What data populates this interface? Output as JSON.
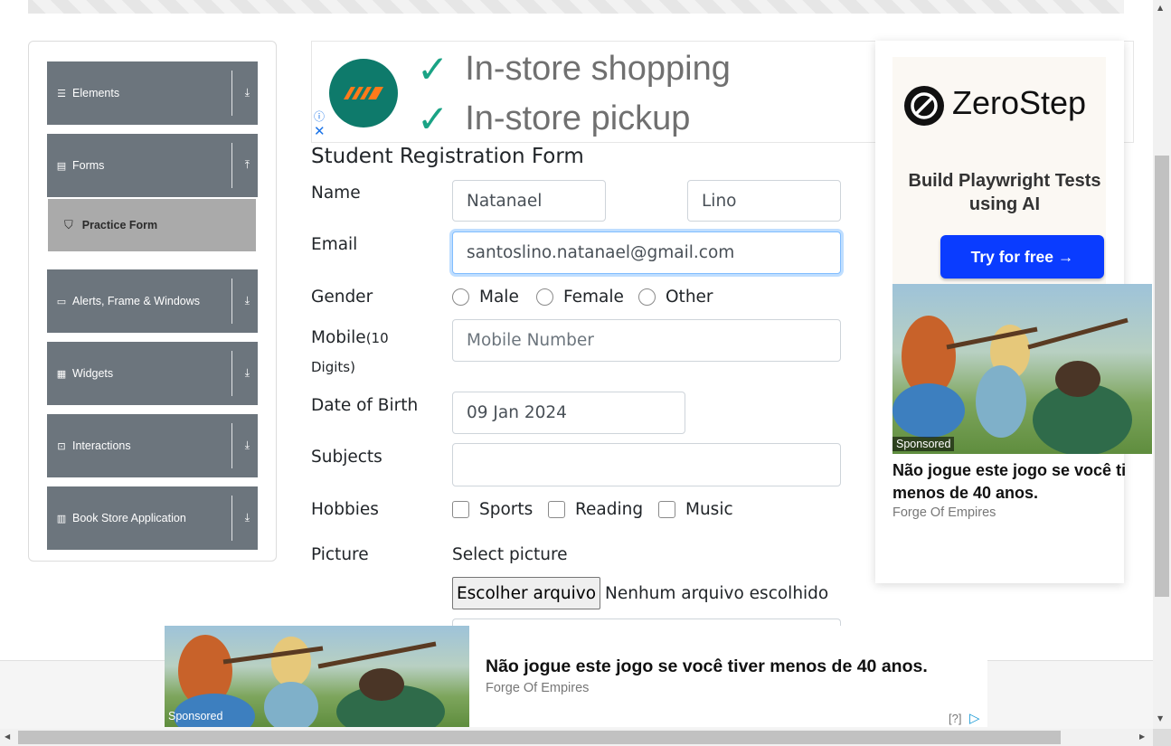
{
  "sidebar": {
    "groups": [
      {
        "label": "Elements",
        "icon": "menu-icon",
        "arrow": "⤓"
      },
      {
        "label": "Forms",
        "icon": "document-icon",
        "arrow": "⤒"
      },
      {
        "label": "Alerts, Frame & Windows",
        "icon": "window-icon",
        "arrow": "⤓"
      },
      {
        "label": "Widgets",
        "icon": "grid-icon",
        "arrow": "⤓"
      },
      {
        "label": "Interactions",
        "icon": "cursor-icon",
        "arrow": "⤓"
      },
      {
        "label": "Book Store Application",
        "icon": "books-icon",
        "arrow": "⤓"
      }
    ],
    "active_item": "Practice Form"
  },
  "ad_top": {
    "line1": "In-store shopping",
    "line2": "In-store pickup"
  },
  "form": {
    "title": "Student Registration Form",
    "name_label": "Name",
    "first_name": "Natanael",
    "last_name": "Lino",
    "email_label": "Email",
    "email": "santoslino.natanael@gmail.com",
    "gender_label": "Gender",
    "genders": [
      "Male",
      "Female",
      "Other"
    ],
    "mobile_label": "Mobile",
    "mobile_hint": "(10",
    "mobile_hint2": "Digits)",
    "mobile_placeholder": "Mobile Number",
    "dob_label": "Date of Birth",
    "dob": "09 Jan 2024",
    "subjects_label": "Subjects",
    "hobbies_label": "Hobbies",
    "hobbies": [
      "Sports",
      "Reading",
      "Music"
    ],
    "picture_label": "Picture",
    "select_picture": "Select picture",
    "file_button": "Escolher arquivo",
    "file_status": "Nenhum arquivo escolhido"
  },
  "ad_right": {
    "brand": "ZeroStep",
    "tagline": "Build Playwright Tests using AI",
    "cta": "Try for free →",
    "sponsored": "Sponsored",
    "headline": "Não jogue este jogo se você ti menos de 40 anos.",
    "source": "Forge Of Empires"
  },
  "ad_bottom": {
    "sponsored": "Sponsored",
    "headline": "Não jogue este jogo se você tiver menos de 40 anos.",
    "source": "Forge Of Empires",
    "help": "[?]"
  },
  "colors": {
    "sidebar_group": "#6c757d",
    "active_item": "#aaaaaa",
    "cta": "#0a3cff",
    "focus": "#80bdff"
  }
}
